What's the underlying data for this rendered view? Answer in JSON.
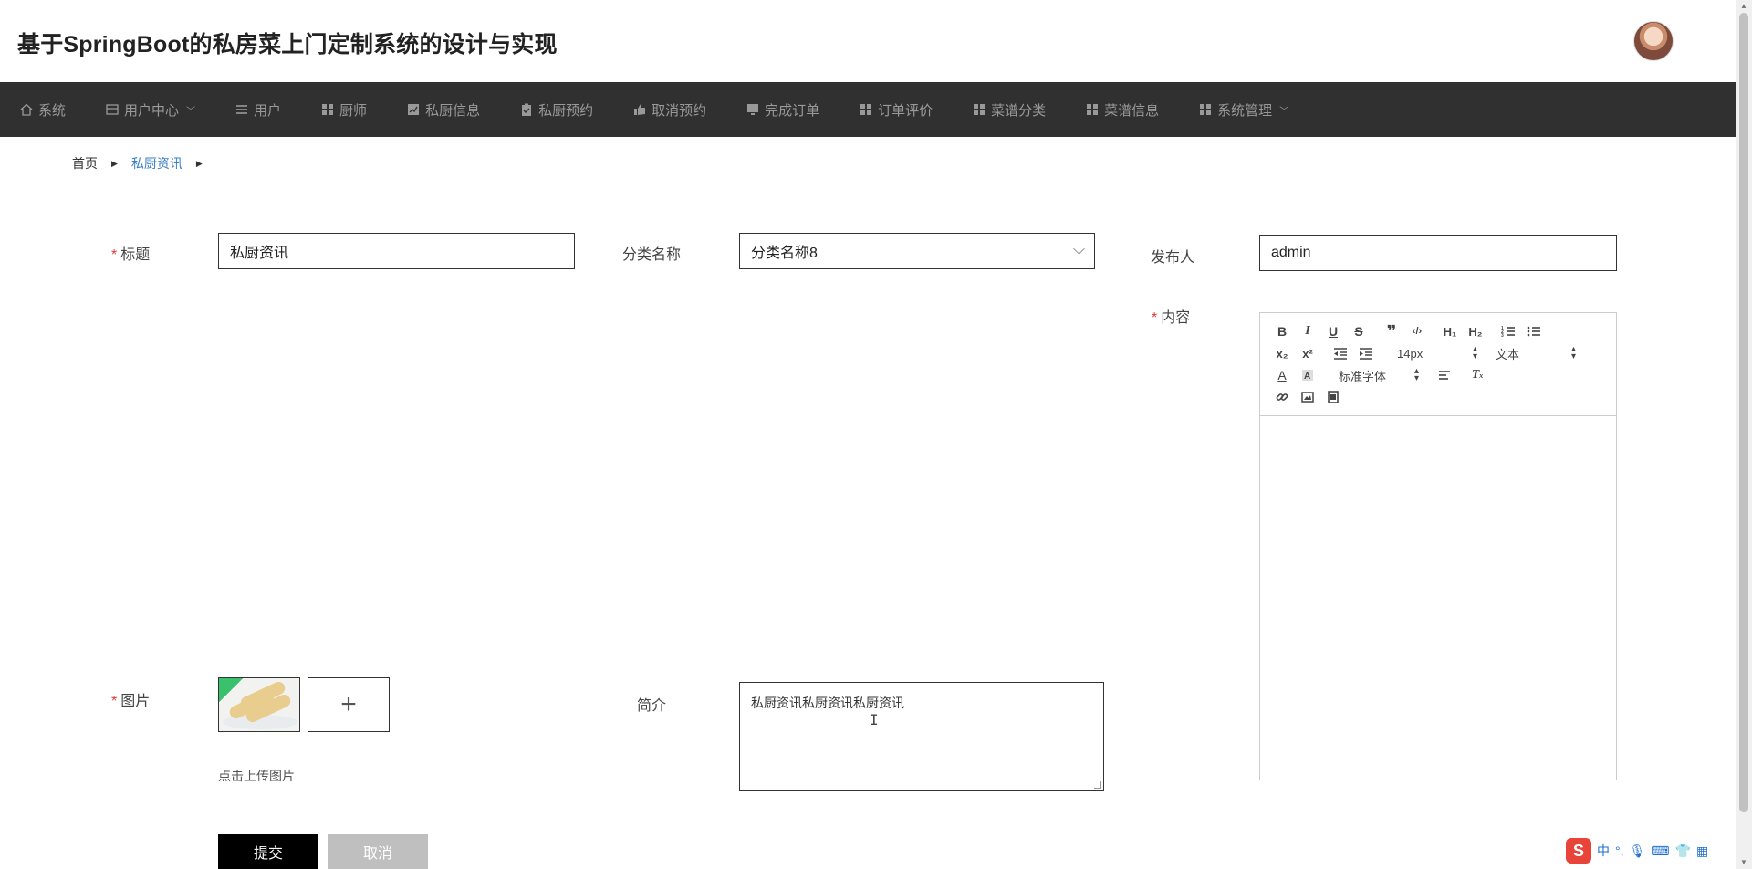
{
  "header": {
    "title": "基于SpringBoot的私房菜上门定制系统的设计与实现"
  },
  "nav": {
    "items": [
      {
        "label": "系统",
        "icon": "home-icon",
        "dropdown": false
      },
      {
        "label": "用户中心",
        "icon": "card-icon",
        "dropdown": true
      },
      {
        "label": "用户",
        "icon": "list-icon",
        "dropdown": false
      },
      {
        "label": "厨师",
        "icon": "grid-icon",
        "dropdown": false
      },
      {
        "label": "私厨信息",
        "icon": "chart-icon",
        "dropdown": false
      },
      {
        "label": "私厨预约",
        "icon": "clipboard-icon",
        "dropdown": false
      },
      {
        "label": "取消预约",
        "icon": "thumb-icon",
        "dropdown": false
      },
      {
        "label": "完成订单",
        "icon": "monitor-icon",
        "dropdown": false
      },
      {
        "label": "订单评价",
        "icon": "grid-icon",
        "dropdown": false
      },
      {
        "label": "菜谱分类",
        "icon": "grid-icon",
        "dropdown": false
      },
      {
        "label": "菜谱信息",
        "icon": "grid-icon",
        "dropdown": false
      },
      {
        "label": "系统管理",
        "icon": "grid-icon",
        "dropdown": true
      }
    ]
  },
  "breadcrumb": {
    "home": "首页",
    "current": "私厨资讯"
  },
  "form": {
    "title_label": "标题",
    "title_value": "私厨资讯",
    "category_label": "分类名称",
    "category_value": "分类名称8",
    "publisher_label": "发布人",
    "publisher_value": "admin",
    "content_label": "内容",
    "image_label": "图片",
    "upload_tip": "点击上传图片",
    "intro_label": "简介",
    "intro_value": "私厨资讯私厨资讯私厨资讯",
    "submit_label": "提交",
    "cancel_label": "取消"
  },
  "editor": {
    "font_size": "14px",
    "block_type": "文本",
    "font_family": "标准字体"
  },
  "ime": {
    "mode": "中"
  },
  "colors": {
    "nav_bg": "#303030",
    "accent_link": "#3a7fc4",
    "required": "#e0393e",
    "submit_bg": "#000000",
    "cancel_bg": "#bfbfbf"
  }
}
